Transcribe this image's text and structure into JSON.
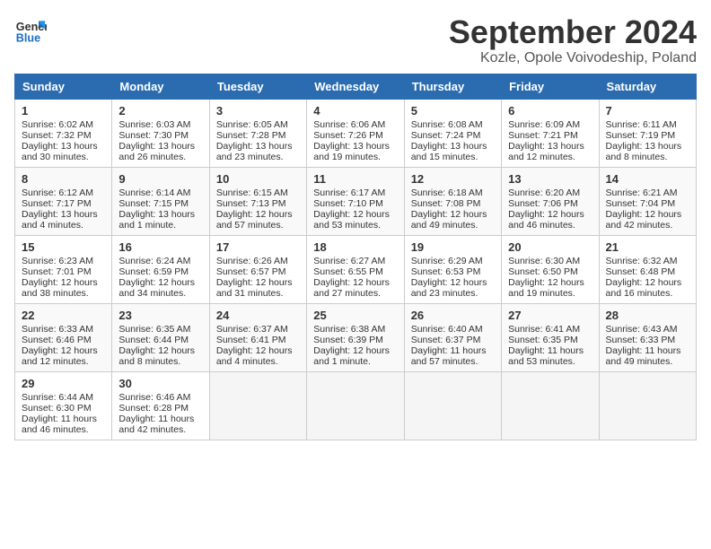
{
  "logo": {
    "line1": "General",
    "line2": "Blue"
  },
  "title": "September 2024",
  "location": "Kozle, Opole Voivodeship, Poland",
  "weekdays": [
    "Sunday",
    "Monday",
    "Tuesday",
    "Wednesday",
    "Thursday",
    "Friday",
    "Saturday"
  ],
  "weeks": [
    [
      {
        "day": "1",
        "sunrise": "Sunrise: 6:02 AM",
        "sunset": "Sunset: 7:32 PM",
        "daylight": "Daylight: 13 hours and 30 minutes."
      },
      {
        "day": "2",
        "sunrise": "Sunrise: 6:03 AM",
        "sunset": "Sunset: 7:30 PM",
        "daylight": "Daylight: 13 hours and 26 minutes."
      },
      {
        "day": "3",
        "sunrise": "Sunrise: 6:05 AM",
        "sunset": "Sunset: 7:28 PM",
        "daylight": "Daylight: 13 hours and 23 minutes."
      },
      {
        "day": "4",
        "sunrise": "Sunrise: 6:06 AM",
        "sunset": "Sunset: 7:26 PM",
        "daylight": "Daylight: 13 hours and 19 minutes."
      },
      {
        "day": "5",
        "sunrise": "Sunrise: 6:08 AM",
        "sunset": "Sunset: 7:24 PM",
        "daylight": "Daylight: 13 hours and 15 minutes."
      },
      {
        "day": "6",
        "sunrise": "Sunrise: 6:09 AM",
        "sunset": "Sunset: 7:21 PM",
        "daylight": "Daylight: 13 hours and 12 minutes."
      },
      {
        "day": "7",
        "sunrise": "Sunrise: 6:11 AM",
        "sunset": "Sunset: 7:19 PM",
        "daylight": "Daylight: 13 hours and 8 minutes."
      }
    ],
    [
      {
        "day": "8",
        "sunrise": "Sunrise: 6:12 AM",
        "sunset": "Sunset: 7:17 PM",
        "daylight": "Daylight: 13 hours and 4 minutes."
      },
      {
        "day": "9",
        "sunrise": "Sunrise: 6:14 AM",
        "sunset": "Sunset: 7:15 PM",
        "daylight": "Daylight: 13 hours and 1 minute."
      },
      {
        "day": "10",
        "sunrise": "Sunrise: 6:15 AM",
        "sunset": "Sunset: 7:13 PM",
        "daylight": "Daylight: 12 hours and 57 minutes."
      },
      {
        "day": "11",
        "sunrise": "Sunrise: 6:17 AM",
        "sunset": "Sunset: 7:10 PM",
        "daylight": "Daylight: 12 hours and 53 minutes."
      },
      {
        "day": "12",
        "sunrise": "Sunrise: 6:18 AM",
        "sunset": "Sunset: 7:08 PM",
        "daylight": "Daylight: 12 hours and 49 minutes."
      },
      {
        "day": "13",
        "sunrise": "Sunrise: 6:20 AM",
        "sunset": "Sunset: 7:06 PM",
        "daylight": "Daylight: 12 hours and 46 minutes."
      },
      {
        "day": "14",
        "sunrise": "Sunrise: 6:21 AM",
        "sunset": "Sunset: 7:04 PM",
        "daylight": "Daylight: 12 hours and 42 minutes."
      }
    ],
    [
      {
        "day": "15",
        "sunrise": "Sunrise: 6:23 AM",
        "sunset": "Sunset: 7:01 PM",
        "daylight": "Daylight: 12 hours and 38 minutes."
      },
      {
        "day": "16",
        "sunrise": "Sunrise: 6:24 AM",
        "sunset": "Sunset: 6:59 PM",
        "daylight": "Daylight: 12 hours and 34 minutes."
      },
      {
        "day": "17",
        "sunrise": "Sunrise: 6:26 AM",
        "sunset": "Sunset: 6:57 PM",
        "daylight": "Daylight: 12 hours and 31 minutes."
      },
      {
        "day": "18",
        "sunrise": "Sunrise: 6:27 AM",
        "sunset": "Sunset: 6:55 PM",
        "daylight": "Daylight: 12 hours and 27 minutes."
      },
      {
        "day": "19",
        "sunrise": "Sunrise: 6:29 AM",
        "sunset": "Sunset: 6:53 PM",
        "daylight": "Daylight: 12 hours and 23 minutes."
      },
      {
        "day": "20",
        "sunrise": "Sunrise: 6:30 AM",
        "sunset": "Sunset: 6:50 PM",
        "daylight": "Daylight: 12 hours and 19 minutes."
      },
      {
        "day": "21",
        "sunrise": "Sunrise: 6:32 AM",
        "sunset": "Sunset: 6:48 PM",
        "daylight": "Daylight: 12 hours and 16 minutes."
      }
    ],
    [
      {
        "day": "22",
        "sunrise": "Sunrise: 6:33 AM",
        "sunset": "Sunset: 6:46 PM",
        "daylight": "Daylight: 12 hours and 12 minutes."
      },
      {
        "day": "23",
        "sunrise": "Sunrise: 6:35 AM",
        "sunset": "Sunset: 6:44 PM",
        "daylight": "Daylight: 12 hours and 8 minutes."
      },
      {
        "day": "24",
        "sunrise": "Sunrise: 6:37 AM",
        "sunset": "Sunset: 6:41 PM",
        "daylight": "Daylight: 12 hours and 4 minutes."
      },
      {
        "day": "25",
        "sunrise": "Sunrise: 6:38 AM",
        "sunset": "Sunset: 6:39 PM",
        "daylight": "Daylight: 12 hours and 1 minute."
      },
      {
        "day": "26",
        "sunrise": "Sunrise: 6:40 AM",
        "sunset": "Sunset: 6:37 PM",
        "daylight": "Daylight: 11 hours and 57 minutes."
      },
      {
        "day": "27",
        "sunrise": "Sunrise: 6:41 AM",
        "sunset": "Sunset: 6:35 PM",
        "daylight": "Daylight: 11 hours and 53 minutes."
      },
      {
        "day": "28",
        "sunrise": "Sunrise: 6:43 AM",
        "sunset": "Sunset: 6:33 PM",
        "daylight": "Daylight: 11 hours and 49 minutes."
      }
    ],
    [
      {
        "day": "29",
        "sunrise": "Sunrise: 6:44 AM",
        "sunset": "Sunset: 6:30 PM",
        "daylight": "Daylight: 11 hours and 46 minutes."
      },
      {
        "day": "30",
        "sunrise": "Sunrise: 6:46 AM",
        "sunset": "Sunset: 6:28 PM",
        "daylight": "Daylight: 11 hours and 42 minutes."
      },
      null,
      null,
      null,
      null,
      null
    ]
  ]
}
